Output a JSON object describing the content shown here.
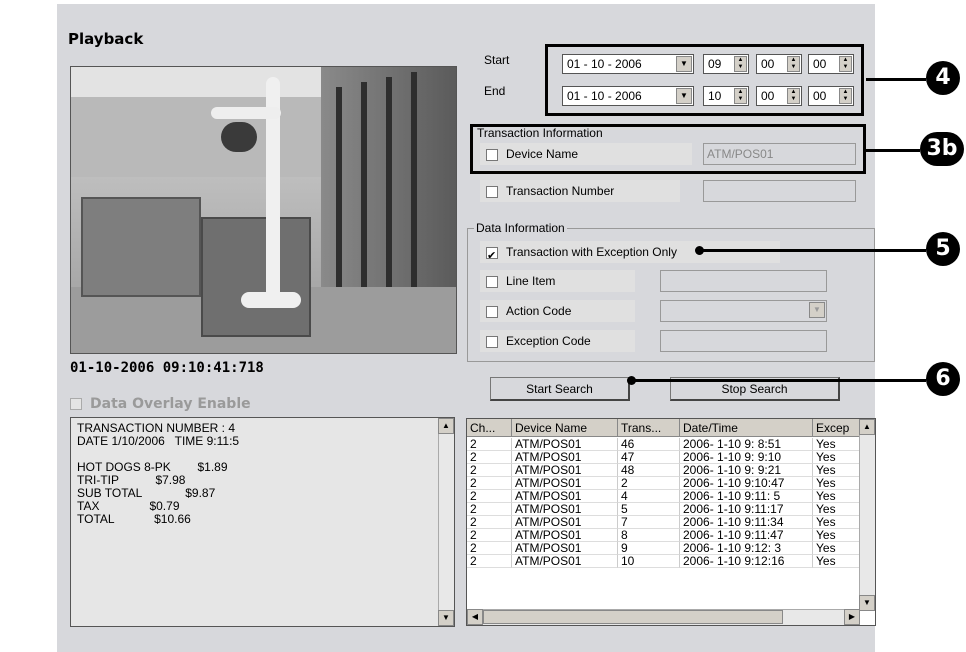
{
  "title": "Playback",
  "timestamp": "01-10-2006 09:10:41:718",
  "overlay": {
    "label": "Data Overlay Enable",
    "checked": false
  },
  "receipt_text": "TRANSACTION NUMBER : 4\nDATE 1/10/2006   TIME 9:11:5\n\nHOT DOGS 8-PK        $1.89\nTRI-TIP           $7.98\nSUB TOTAL             $9.87\nTAX               $0.79\nTOTAL            $10.66",
  "range": {
    "start_label": "Start",
    "end_label": "End",
    "start_date": "01 - 10 - 2006",
    "end_date": "01 - 10 - 2006",
    "start_h": "09",
    "start_m": "00",
    "start_s": "00",
    "end_h": "10",
    "end_m": "00",
    "end_s": "00"
  },
  "transaction": {
    "group_label": "Transaction Information",
    "device_name_label": "Device Name",
    "device_name_value": "ATM/POS01",
    "transaction_number_label": "Transaction Number",
    "transaction_number_value": ""
  },
  "data_info": {
    "group_label": "Data Information",
    "exception_only_label": "Transaction with Exception Only",
    "exception_only_checked": true,
    "line_item_label": "Line Item",
    "action_code_label": "Action Code",
    "exception_code_label": "Exception Code"
  },
  "buttons": {
    "start_search": "Start Search",
    "stop_search": "Stop Search"
  },
  "callouts": {
    "c4": "4",
    "c3b": "3b",
    "c5": "5",
    "c6": "6"
  },
  "table": {
    "headers": [
      "Ch...",
      "Device Name",
      "Trans...",
      "Date/Time",
      "Excep"
    ],
    "rows": [
      [
        "2",
        "ATM/POS01",
        "46",
        "2006- 1-10  9: 8:51",
        "Yes"
      ],
      [
        "2",
        "ATM/POS01",
        "47",
        "2006- 1-10  9: 9:10",
        "Yes"
      ],
      [
        "2",
        "ATM/POS01",
        "48",
        "2006- 1-10  9: 9:21",
        "Yes"
      ],
      [
        "2",
        "ATM/POS01",
        "2",
        "2006- 1-10  9:10:47",
        "Yes"
      ],
      [
        "2",
        "ATM/POS01",
        "4",
        "2006- 1-10  9:11: 5",
        "Yes"
      ],
      [
        "2",
        "ATM/POS01",
        "5",
        "2006- 1-10  9:11:17",
        "Yes"
      ],
      [
        "2",
        "ATM/POS01",
        "7",
        "2006- 1-10  9:11:34",
        "Yes"
      ],
      [
        "2",
        "ATM/POS01",
        "8",
        "2006- 1-10  9:11:47",
        "Yes"
      ],
      [
        "2",
        "ATM/POS01",
        "9",
        "2006- 1-10  9:12: 3",
        "Yes"
      ],
      [
        "2",
        "ATM/POS01",
        "10",
        "2006- 1-10  9:12:16",
        "Yes"
      ]
    ]
  }
}
